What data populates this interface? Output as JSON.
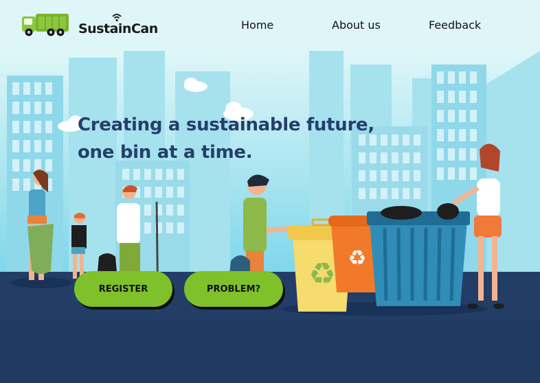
{
  "brand": {
    "name": "SustainCan"
  },
  "nav": {
    "home": "Home",
    "about": "About us",
    "feedback": "Feedback"
  },
  "hero": {
    "headline_line1": "Creating a sustainable future,",
    "headline_line2": "one bin at a time."
  },
  "buttons": {
    "register": "REGISTER",
    "problem": "PROBLEM?"
  },
  "colors": {
    "nav_bg": "#dff6f8",
    "headline": "#243f6b",
    "button_green": "#7ec12a",
    "ground": "#223e66"
  }
}
